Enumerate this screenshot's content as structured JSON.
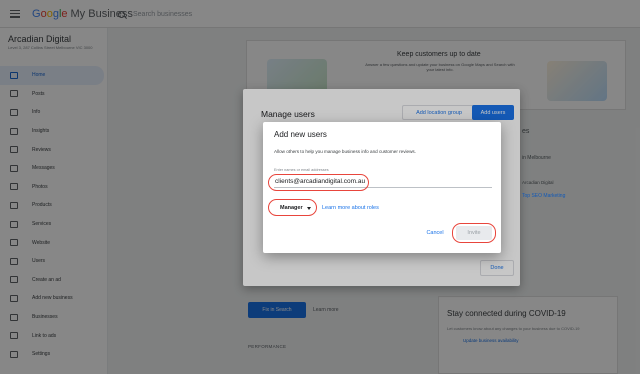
{
  "topbar": {
    "brand_google": [
      "G",
      "o",
      "o",
      "g",
      "l",
      "e"
    ],
    "brand_rest": "My Business",
    "search_placeholder": "Search businesses"
  },
  "sidebar": {
    "business_name": "Arcadian Digital",
    "business_address": "Level 3, 287 Collins Street Melbourne VIC 3000",
    "items": [
      {
        "label": "Home",
        "icon": "home-icon",
        "active": true
      },
      {
        "label": "Posts",
        "icon": "posts-icon"
      },
      {
        "label": "Info",
        "icon": "info-icon"
      },
      {
        "label": "Insights",
        "icon": "insights-icon"
      },
      {
        "label": "Reviews",
        "icon": "reviews-icon"
      },
      {
        "label": "Messages",
        "icon": "messages-icon"
      },
      {
        "label": "Photos",
        "icon": "photos-icon"
      },
      {
        "label": "Products",
        "icon": "products-icon"
      },
      {
        "label": "Services",
        "icon": "services-icon"
      },
      {
        "label": "Website",
        "icon": "website-icon"
      },
      {
        "label": "Users",
        "icon": "users-icon"
      },
      {
        "label": "Create an ad",
        "icon": "ads-icon"
      },
      {
        "label": "Add new business",
        "icon": "add-business-icon"
      },
      {
        "label": "Businesses",
        "icon": "businesses-icon"
      },
      {
        "label": "Link to ads",
        "icon": "link-icon"
      },
      {
        "label": "Settings",
        "icon": "settings-icon"
      }
    ]
  },
  "main": {
    "card_title": "Keep customers up to date",
    "card_body": "Answer a few questions and update your business on Google Maps and Search with your latest info.",
    "cta": "Fix in Search",
    "learn_more": "Learn more",
    "performance": "PERFORMANCE",
    "covid_title": "Stay connected during COVID-19",
    "covid_body": "Let customers know about any changes to your business due to COVID-19",
    "covid_link": "Update business availability"
  },
  "peek": {
    "heading": "es",
    "search": "in Melbourne",
    "line1": "Arcadian Digital",
    "line2": "Top SEO Marketing"
  },
  "manage_users": {
    "title": "Manage users",
    "add_location_group": "Add location group",
    "add_users": "Add users",
    "done": "Done"
  },
  "add_users": {
    "title": "Add new users",
    "description": "Allow others to help you manage business info and customer reviews.",
    "field_label": "Enter names or email addresses",
    "email_value": "clients@arcadiandigital.com.au",
    "role_value": "Manager",
    "learn_roles": "Learn more about roles",
    "cancel": "Cancel",
    "invite": "Invite"
  },
  "colors": {
    "accent": "#1a73e8",
    "highlight_ring": "#e8453c"
  }
}
